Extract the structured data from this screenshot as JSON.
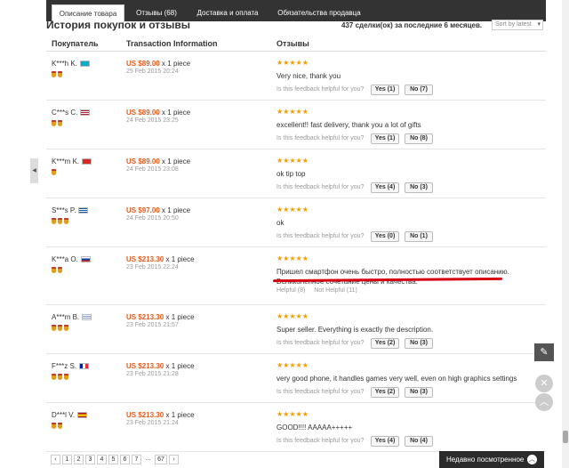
{
  "tabs": [
    {
      "label": "Описание товара",
      "active": true
    },
    {
      "label": "Отзывы (68)",
      "active": false
    },
    {
      "label": "Доставка и оплата",
      "active": false
    },
    {
      "label": "Обязательства продавца",
      "active": false
    }
  ],
  "section_title": "История покупок и отзывы",
  "deal_count": "437 сделки(ок) за последние 6 месяцев.",
  "sort_label": "Sort by latest",
  "columns": {
    "buyer": "Покупатель",
    "transaction": "Transaction Information",
    "feedback": "Отзывы"
  },
  "helpful_question": "Is this feedback helpful for you?",
  "rows": [
    {
      "buyer": "K***h K.",
      "flag": "kz",
      "medals": 2,
      "price": "US $89.00",
      "qty": "x 1 piece",
      "date": "25 Feb 2015 20:24",
      "stars": "★★★★★",
      "text": "Very nice, thank you",
      "yes": "Yes (1)",
      "no": "No (7)"
    },
    {
      "buyer": "C***s C.",
      "flag": "us",
      "medals": 2,
      "price": "US $89.00",
      "qty": "x 1 piece",
      "date": "24 Feb 2015 23:25",
      "stars": "★★★★★",
      "text": "excellent!! fast delivery, thank you a lot of gifts",
      "yes": "Yes (1)",
      "no": "No (8)"
    },
    {
      "buyer": "K***m K.",
      "flag": "ch",
      "medals": 1,
      "price": "US $89.00",
      "qty": "x 1 piece",
      "date": "24 Feb 2015 23:08",
      "stars": "★★★★★",
      "text": "ok tip top",
      "yes": "Yes (4)",
      "no": "No (3)"
    },
    {
      "buyer": "S***s P.",
      "flag": "gr",
      "medals": 3,
      "price": "US $97.00",
      "qty": "x 1 piece",
      "date": "24 Feb 2015 20:50",
      "stars": "★★★★★",
      "text": "ok",
      "yes": "Yes (0)",
      "no": "No (1)"
    },
    {
      "buyer": "K***a O.",
      "flag": "ru",
      "medals": 2,
      "price": "US $213.30",
      "qty": "x 1 piece",
      "date": "23 Feb 2015 22:24",
      "stars": "★★★★★",
      "text": "Пришел смартфон очень быстро, полностью соответствует описанию. Великолепное сочетание цены и качества.",
      "helpful": "Helpful (8)",
      "not_helpful": "Not Helpful (11)"
    },
    {
      "buyer": "A***m B.",
      "flag": "il",
      "medals": 3,
      "price": "US $213.30",
      "qty": "x 1 piece",
      "date": "23 Feb 2015 21:57",
      "stars": "★★★★★",
      "text": "Super seller. Everything is exactly the description.",
      "yes": "Yes (2)",
      "no": "No (3)"
    },
    {
      "buyer": "F***z S.",
      "flag": "fr",
      "medals": 3,
      "price": "US $213.30",
      "qty": "x 1 piece",
      "date": "23 Feb 2015 21:28",
      "stars": "★★★★★",
      "text": "very good phone, it handles games very well, even on high graphics settings",
      "yes": "Yes (2)",
      "no": "No (3)"
    },
    {
      "buyer": "D***l V.",
      "flag": "es",
      "medals": 2,
      "price": "US $213.30",
      "qty": "x 1 piece",
      "date": "23 Feb 2015 21:24",
      "stars": "★★★★★",
      "text": "GOOD!!!! AAAAA+++++",
      "yes": "Yes (4)",
      "no": "No (4)"
    }
  ],
  "pager": {
    "prev": "‹",
    "pages": [
      "1",
      "2",
      "3",
      "4",
      "5",
      "6",
      "7"
    ],
    "ellipsis": "...",
    "last": "67",
    "next": "›"
  },
  "recently_viewed": "Недавно посмотренное",
  "icons": {
    "edit": "pencil-icon",
    "close": "close-icon",
    "up": "chevron-up-icon",
    "left": "chevron-left-icon"
  }
}
